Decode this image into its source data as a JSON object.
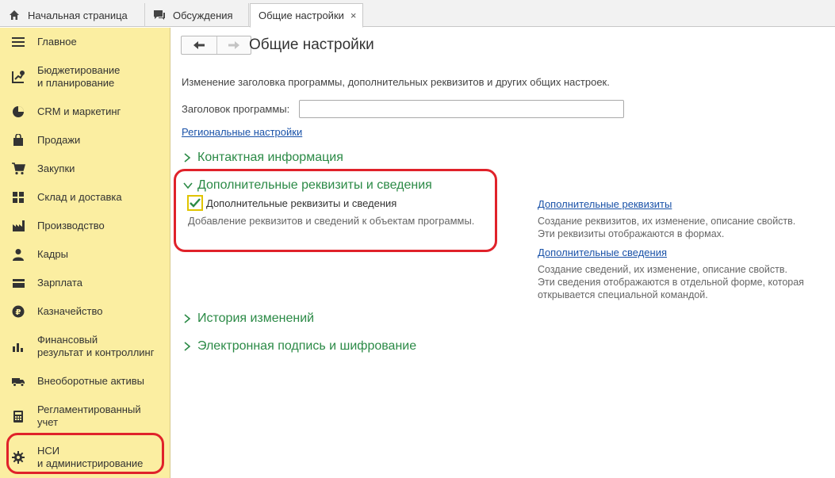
{
  "tabs": [
    {
      "label": "Начальная страница",
      "icon": "home-icon"
    },
    {
      "label": "Обсуждения",
      "icon": "chat-icon"
    },
    {
      "label": "Общие настройки",
      "icon": "",
      "close": "×"
    }
  ],
  "sidebar": {
    "items": [
      {
        "label": "Главное",
        "icon": "menu-icon"
      },
      {
        "label": "Бюджетирование\nи планирование",
        "icon": "budget-chart-icon"
      },
      {
        "label": "CRM и маркетинг",
        "icon": "pie-chart-icon"
      },
      {
        "label": "Продажи",
        "icon": "shopping-bag-icon"
      },
      {
        "label": "Закупки",
        "icon": "cart-icon"
      },
      {
        "label": "Склад и доставка",
        "icon": "warehouse-grid-icon"
      },
      {
        "label": "Производство",
        "icon": "factory-icon"
      },
      {
        "label": "Кадры",
        "icon": "person-icon"
      },
      {
        "label": "Зарплата",
        "icon": "wallet-icon"
      },
      {
        "label": "Казначейство",
        "icon": "ruble-coin-icon"
      },
      {
        "label": "Финансовый\nрезультат и контроллинг",
        "icon": "bar-chart-icon"
      },
      {
        "label": "Внеоборотные активы",
        "icon": "truck-icon"
      },
      {
        "label": "Регламентированный\nучет",
        "icon": "calculator-icon"
      },
      {
        "label": "НСИ\nи администрирование",
        "icon": "gear-icon"
      }
    ]
  },
  "main": {
    "title": "Общие настройки",
    "description": "Изменение заголовка программы, дополнительных реквизитов и других общих настроек.",
    "program_title_label": "Заголовок программы:",
    "program_title_value": "",
    "regional_link": "Региональные настройки",
    "sections": {
      "contact": "Контактная информация",
      "additional": "Дополнительные реквизиты и сведения",
      "history": "История изменений",
      "signature": "Электронная подпись и шифрование"
    },
    "checkbox": {
      "label": "Дополнительные реквизиты и сведения",
      "checked": true,
      "description": "Добавление реквизитов и сведений к объектам программы."
    },
    "right_links": [
      {
        "label": "Дополнительные реквизиты",
        "text": "Создание реквизитов, их изменение, описание свойств.\nЭти реквизиты отображаются в формах."
      },
      {
        "label": "Дополнительные сведения",
        "text": "Создание сведений, их изменение, описание свойств.\nЭти сведения отображаются в отдельной форме, которая\nоткрывается специальной командой."
      }
    ]
  },
  "colors": {
    "sidebar_bg": "#fbeea1",
    "section_green": "#2b8a46",
    "link_blue": "#1a52a8",
    "highlight_red": "#e0222a",
    "checkbox_border": "#e0c400"
  }
}
